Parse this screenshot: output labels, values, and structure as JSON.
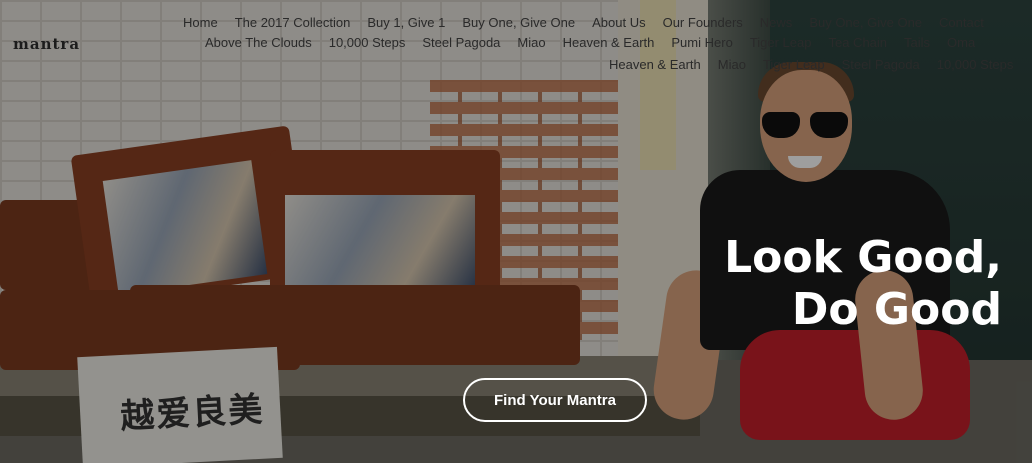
{
  "brand": {
    "logo_text": "mantra"
  },
  "nav": {
    "row1": [
      "Home",
      "The 2017 Collection",
      "Buy 1, Give 1",
      "Buy One, Give One",
      "About Us",
      "Our Founders",
      "News",
      "Buy One, Give One",
      "Contact"
    ],
    "row2": [
      "Above The Clouds",
      "10,000 Steps",
      "Steel Pagoda",
      "Miao",
      "Heaven & Earth",
      "Pumi Hero",
      "Tiger Leap",
      "Tea Chain",
      "Tails",
      "Oma"
    ],
    "row3": [
      "Heaven & Earth",
      "Miao",
      "Tiger Leap",
      "Steel Pagoda",
      "10,000 Steps"
    ]
  },
  "hero": {
    "headline_line1": "Look Good,",
    "headline_line2": "Do Good",
    "cta_label": "Find Your Mantra",
    "sign_text": "越爱良美"
  }
}
